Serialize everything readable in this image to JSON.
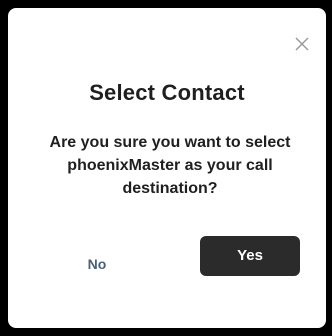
{
  "dialog": {
    "title": "Select Contact",
    "message": "Are you sure you want to select phoenixMaster as your call destination?",
    "close_icon": "close-icon",
    "no_label": "No",
    "yes_label": "Yes"
  },
  "colors": {
    "backdrop": "#000000",
    "dialog_background": "#ffffff",
    "yes_button": "#2b2b2b",
    "no_text": "#4a5f7a"
  }
}
